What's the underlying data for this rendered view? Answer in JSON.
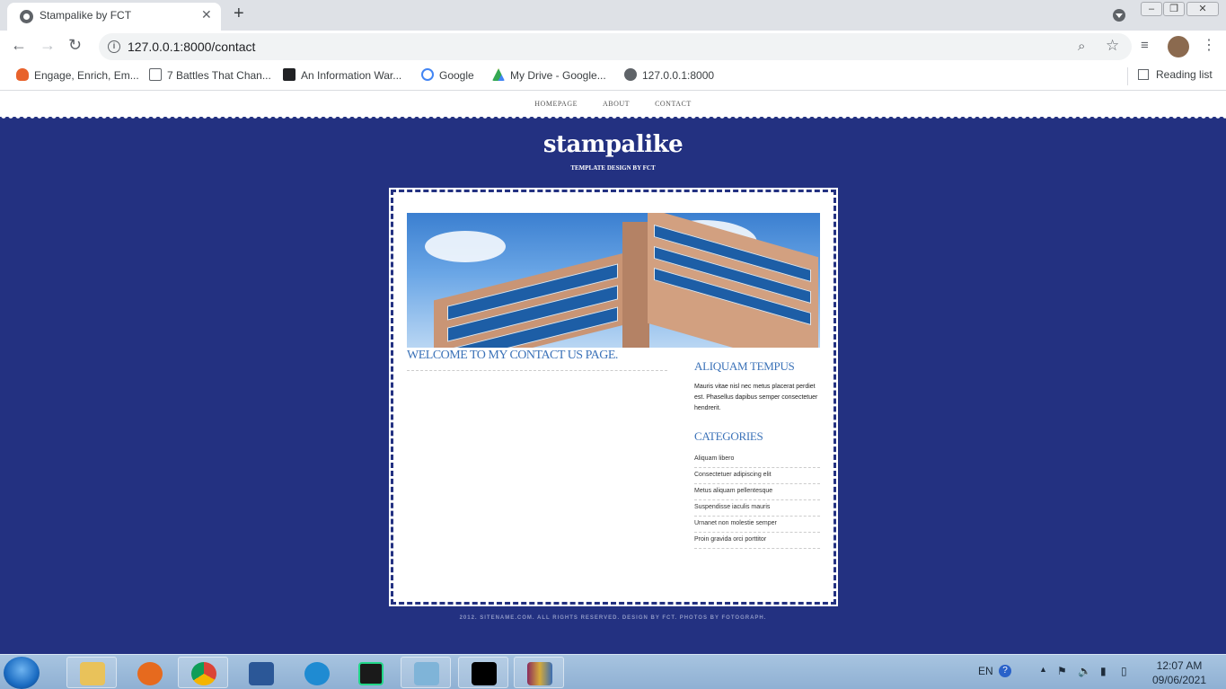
{
  "browser": {
    "tab_title": "Stampalike by FCT",
    "url": "127.0.0.1:8000/contact",
    "bookmarks": [
      {
        "label": "Engage, Enrich, Em...",
        "icon": "flame-icon",
        "color": "#e8622b"
      },
      {
        "label": "7 Battles That Chan...",
        "icon": "page-icon",
        "color": "#5f6368"
      },
      {
        "label": "An Information War...",
        "icon": "dark-square-icon",
        "color": "#202124"
      },
      {
        "label": "Google",
        "icon": "google-icon",
        "color": "#4285f4"
      },
      {
        "label": "My Drive - Google...",
        "icon": "drive-icon",
        "color": "#34a853"
      },
      {
        "label": "127.0.0.1:8000",
        "icon": "globe-icon",
        "color": "#5f6368"
      }
    ],
    "reading_list": "Reading list"
  },
  "site": {
    "nav": [
      "HOMEPAGE",
      "ABOUT",
      "CONTACT"
    ],
    "title": "stampalike",
    "subtitle": "TEMPLATE DESIGN BY FCT",
    "main_heading": "WELCOME TO MY CONTACT US PAGE.",
    "sidebar": {
      "heading1": "ALIQUAM TEMPUS",
      "text": "Mauris vitae nisl nec metus placerat perdiet est. Phasellus dapibus semper consectetuer hendrerit.",
      "heading2": "CATEGORIES",
      "categories": [
        "Aliquam libero",
        "Consectetuer adipiscing elit",
        "Metus aliquam pellentesque",
        "Suspendisse iaculis mauris",
        "Urnanet non molestie semper",
        "Proin gravida orci porttitor"
      ]
    },
    "footer": "2012. SITENAME.COM. ALL RIGHTS RESERVED. DESIGN BY FCT. PHOTOS BY FOTOGRAPH."
  },
  "taskbar": {
    "apps": [
      {
        "name": "explorer",
        "color": "#e9c25a"
      },
      {
        "name": "firefox",
        "color": "#e66a1e"
      },
      {
        "name": "chrome",
        "color": "#3b8d3f"
      },
      {
        "name": "word",
        "color": "#2b5797"
      },
      {
        "name": "edge",
        "color": "#1f8bd2"
      },
      {
        "name": "pycharm",
        "color": "#1a1a1a"
      },
      {
        "name": "notepad",
        "color": "#7fb4d8"
      },
      {
        "name": "cmd",
        "color": "#000000"
      },
      {
        "name": "winrar",
        "color": "#8a2b5c"
      }
    ],
    "language": "EN",
    "time": "12:07 AM",
    "date": "09/06/2021"
  }
}
